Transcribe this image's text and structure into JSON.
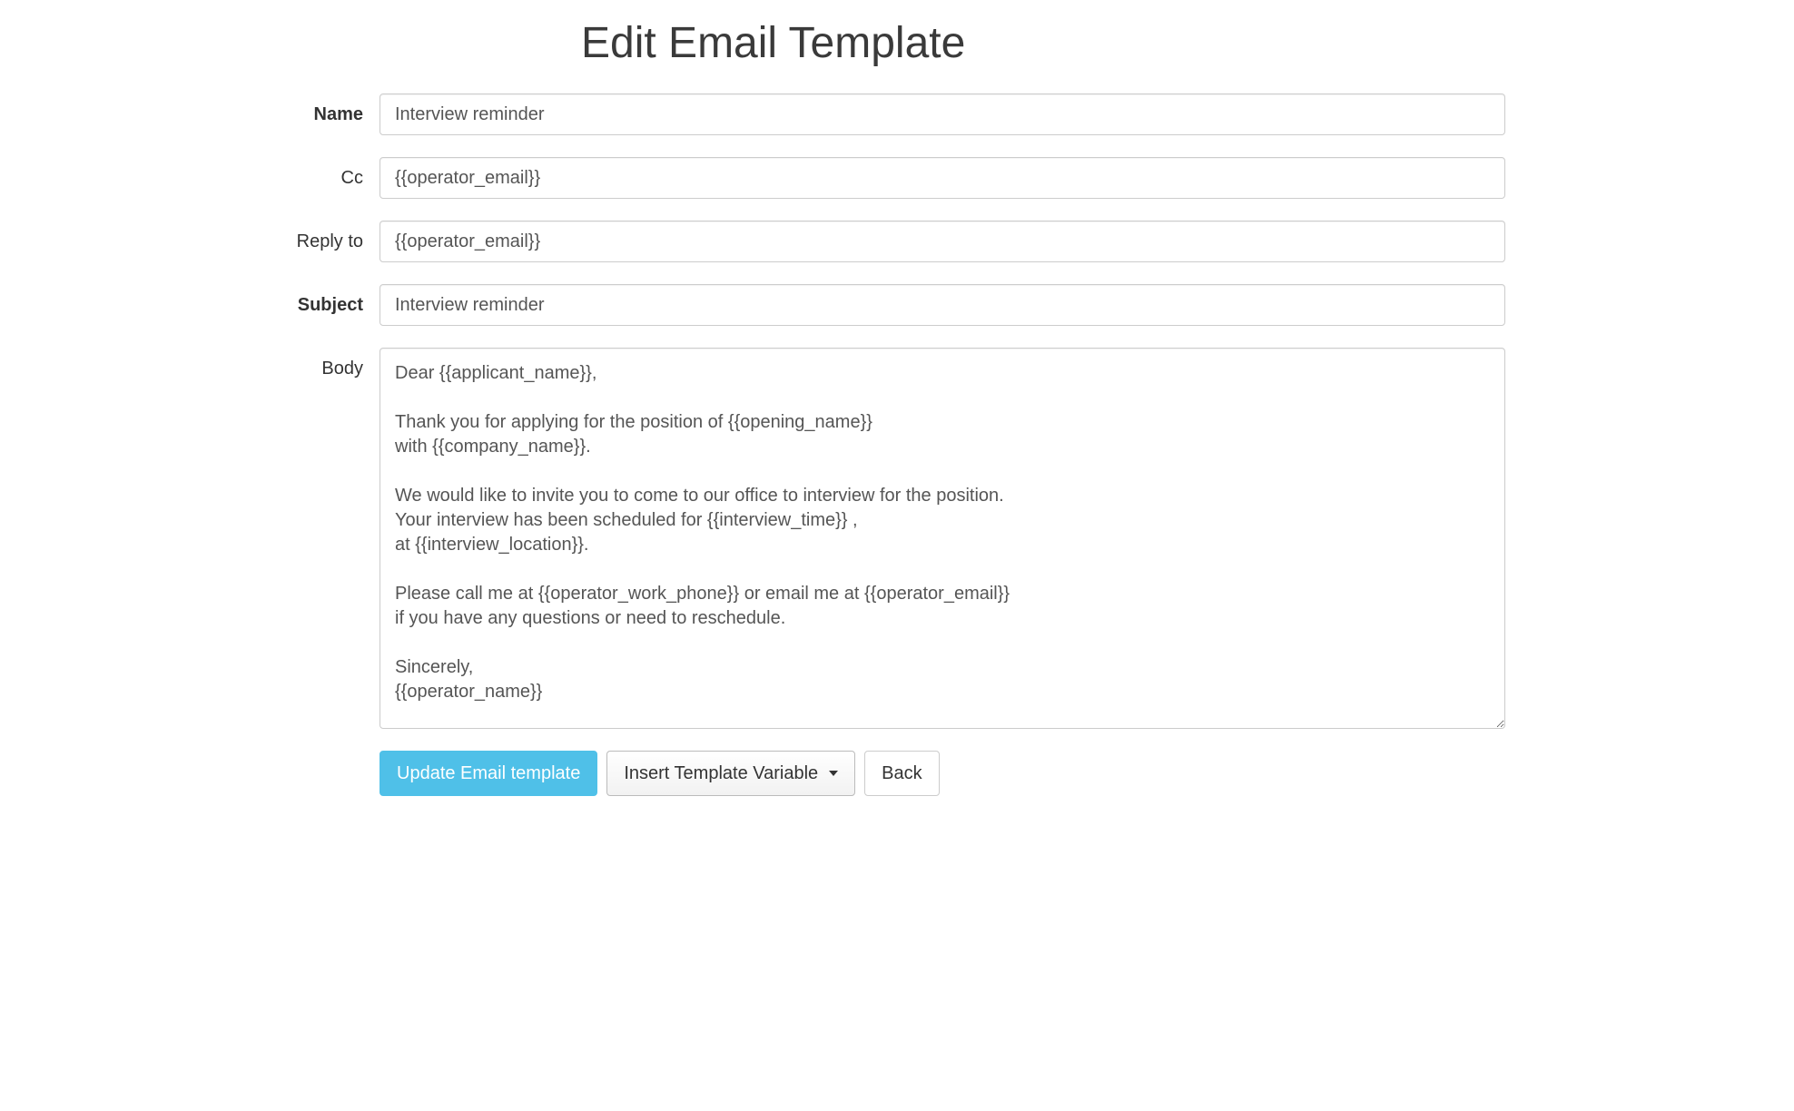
{
  "page": {
    "title": "Edit Email Template"
  },
  "form": {
    "name": {
      "label": "Name",
      "value": "Interview reminder"
    },
    "cc": {
      "label": "Cc",
      "value": "{{operator_email}}"
    },
    "reply_to": {
      "label": "Reply to",
      "value": "{{operator_email}}"
    },
    "subject": {
      "label": "Subject",
      "value": "Interview reminder"
    },
    "body": {
      "label": "Body",
      "value": "Dear {{applicant_name}},\n\nThank you for applying for the position of {{opening_name}}\nwith {{company_name}}.\n\nWe would like to invite you to come to our office to interview for the position.\nYour interview has been scheduled for {{interview_time}} ,\nat {{interview_location}}.\n\nPlease call me at {{operator_work_phone}} or email me at {{operator_email}}\nif you have any questions or need to reschedule.\n\nSincerely,\n{{operator_name}}"
    }
  },
  "buttons": {
    "update": "Update Email template",
    "insert_variable": "Insert Template Variable",
    "back": "Back"
  }
}
